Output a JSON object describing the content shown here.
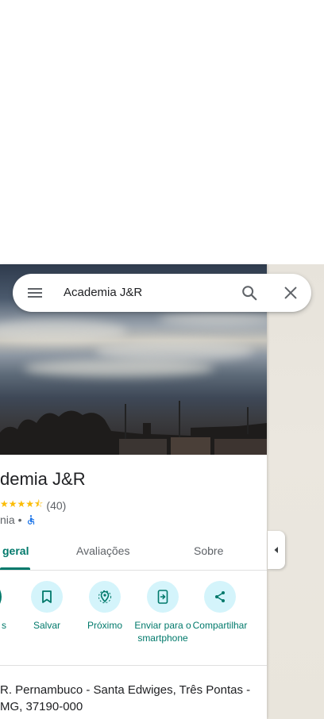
{
  "search": {
    "query": "Academia J&R"
  },
  "place": {
    "title": "demia J&R",
    "rating_count": "(40)",
    "category": "nia •"
  },
  "tabs": [
    {
      "label": "geral"
    },
    {
      "label": "Avaliações"
    },
    {
      "label": "Sobre"
    }
  ],
  "actions": [
    {
      "label": "s"
    },
    {
      "label": "Salvar"
    },
    {
      "label": "Próximo"
    },
    {
      "label": "Enviar para o smartphone"
    },
    {
      "label": "Compartilhar"
    }
  ],
  "address": {
    "text": "R. Pernambuco - Santa Edwiges, Três Pontas - MG, 37190-000"
  },
  "colors": {
    "accent": "#00796b",
    "action_bg": "#d4f4fb",
    "stars": "#fbbc04"
  },
  "icons": [
    "menu-icon",
    "search-icon",
    "close-icon",
    "bookmark-icon",
    "nearby-icon",
    "send-to-phone-icon",
    "share-icon",
    "wheelchair-icon",
    "collapse-arrow-icon"
  ]
}
